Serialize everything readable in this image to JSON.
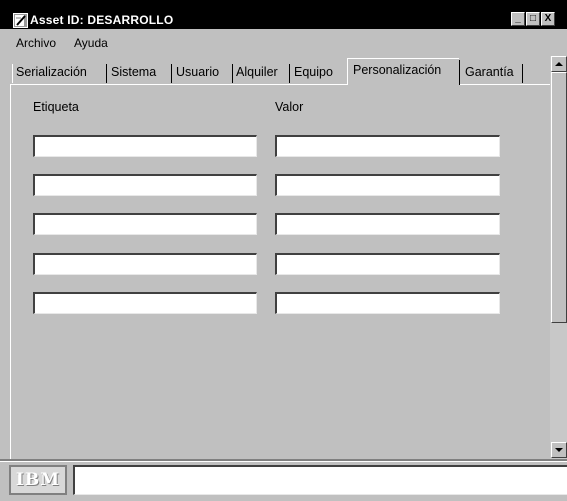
{
  "window": {
    "title": "Asset ID: DESARROLLO",
    "minimize": "_",
    "maximize": "□",
    "close": "X"
  },
  "menu": [
    "Archivo",
    "Ayuda"
  ],
  "tabs": [
    {
      "label": "Serialización",
      "active": false
    },
    {
      "label": "Sistema",
      "active": false
    },
    {
      "label": "Usuario",
      "active": false
    },
    {
      "label": "Alquiler",
      "active": false
    },
    {
      "label": "Equipo",
      "active": false
    },
    {
      "label": "Personalización",
      "active": true
    },
    {
      "label": "Garantía",
      "active": false
    }
  ],
  "form": {
    "label_header": "Etiqueta",
    "value_header": "Valor",
    "rows": [
      {
        "label": "",
        "value": ""
      },
      {
        "label": "",
        "value": ""
      },
      {
        "label": "",
        "value": ""
      },
      {
        "label": "",
        "value": ""
      },
      {
        "label": "",
        "value": ""
      }
    ]
  },
  "footer": {
    "logo_text": "IBM",
    "status_text": ""
  },
  "icons": {
    "app": "pencil-document-icon",
    "scroll_up": "arrow-up-icon",
    "scroll_down": "arrow-down-icon"
  }
}
